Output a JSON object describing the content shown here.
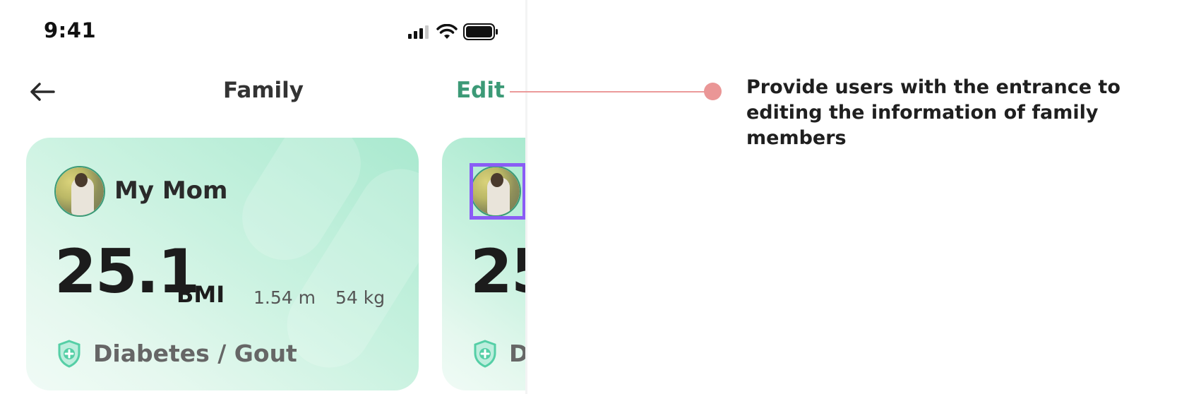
{
  "status_bar": {
    "time": "9:41"
  },
  "header": {
    "back_icon": "arrow-left-icon",
    "title": "Family",
    "edit_label": "Edit"
  },
  "cards": [
    {
      "name": "My Mom",
      "bmi": "25.1",
      "bmi_label": "BMI",
      "height": "1.54 m",
      "weight": "54 kg",
      "conditions": "Diabetes / Gout"
    },
    {
      "bmi_partial": "25",
      "conditions_partial": "D"
    }
  ],
  "annotation": {
    "text": "Provide users with the entrance to editing the information of family members",
    "color": "#ea9696"
  },
  "colors": {
    "accent": "#3c9a77",
    "card_gradient_start": "#a9e9cf",
    "selection": "#8a5cf5"
  }
}
